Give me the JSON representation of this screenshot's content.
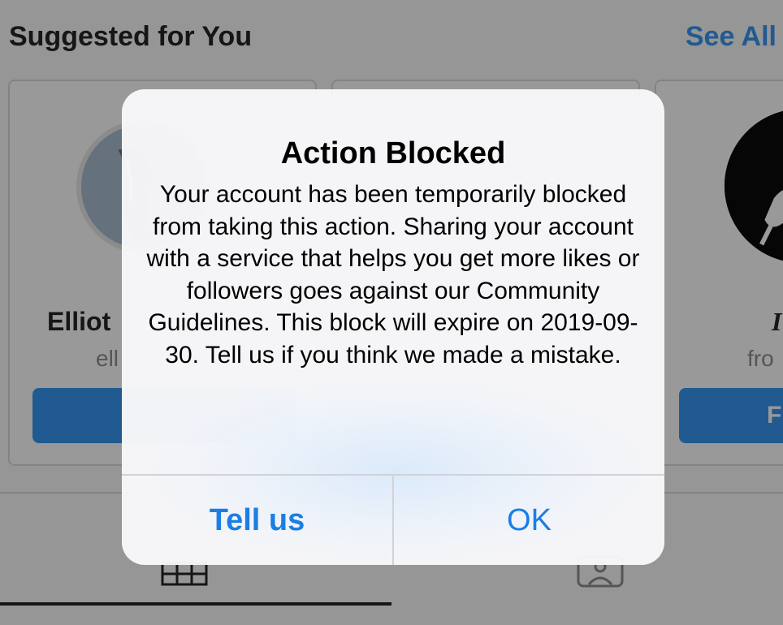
{
  "header": {
    "title": "Suggested for You",
    "see_all": "See All"
  },
  "cards": [
    {
      "name": "Elliot",
      "handle": "ell",
      "follow_label": ""
    },
    {
      "name": "",
      "handle": "",
      "follow_label": ""
    },
    {
      "name": "I",
      "handle": "fro",
      "follow_label": "F"
    }
  ],
  "tabs": [
    {
      "icon": "grid-icon"
    },
    {
      "icon": "tagged-icon"
    }
  ],
  "alert": {
    "title": "Action Blocked",
    "message": "Your account has been temporarily blocked from taking this action. Sharing your account with a service that helps you get more likes or followers goes against our Community Guidelines. This block will expire on 2019-09-30. Tell us if you think we made a mistake.",
    "buttons": {
      "tell_us": "Tell us",
      "ok": "OK"
    }
  },
  "colors": {
    "accent": "#3897f0",
    "alert_button": "#1a7ee6",
    "overlay": "rgba(0,0,0,0.4)"
  }
}
